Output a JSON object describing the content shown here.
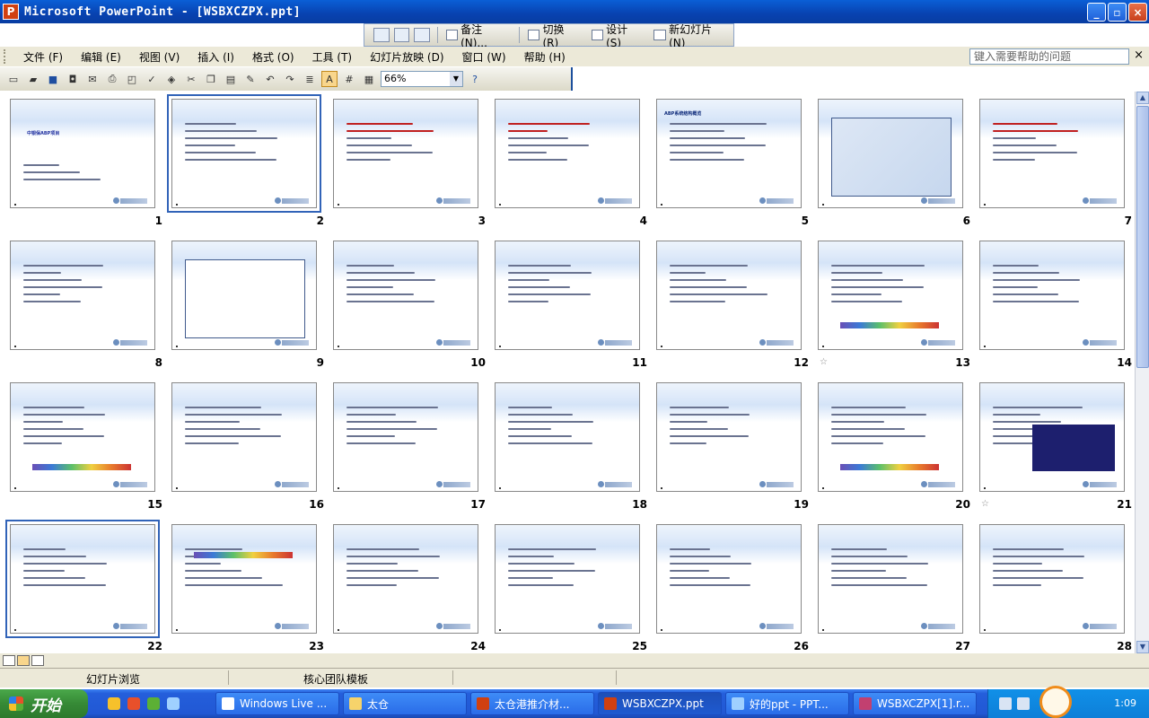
{
  "window": {
    "title": "Microsoft PowerPoint - [WSBXCZPX.ppt]",
    "icon_letter": "P",
    "buttons": [
      "_",
      "▫",
      "×"
    ]
  },
  "float_toolbar": {
    "notes_label": "备注 (N)...",
    "transition_label": "切换 (R)",
    "design_label": "设计 (S)",
    "new_slide_label": "新幻灯片 (N)"
  },
  "menubar": {
    "items": [
      "文件 (F)",
      "编辑 (E)",
      "视图 (V)",
      "插入 (I)",
      "格式 (O)",
      "工具 (T)",
      "幻灯片放映 (D)",
      "窗口 (W)",
      "帮助 (H)"
    ],
    "help_placeholder": "键入需要帮助的问题",
    "close": "×"
  },
  "toolbar": {
    "zoom": "66%",
    "icons": [
      "new-icon",
      "open-icon",
      "save-icon",
      "permission-icon",
      "email-icon",
      "print-icon",
      "print-preview-icon",
      "spelling-icon",
      "research-icon",
      "cut-icon",
      "copy-icon",
      "paste-icon",
      "format-painter-icon",
      "undo-icon",
      "redo-icon",
      "expand-icon",
      "show-formatting-icon",
      "grid-icon",
      "color-icon",
      "help-icon"
    ]
  },
  "slides": [
    {
      "num": "1",
      "title": "中银保ABP项目",
      "kind": "title"
    },
    {
      "num": "2",
      "title": "",
      "kind": "text",
      "selected": true
    },
    {
      "num": "3",
      "title": "",
      "kind": "text"
    },
    {
      "num": "4",
      "title": "",
      "kind": "text"
    },
    {
      "num": "5",
      "title": "ABP系统结构概览",
      "kind": "text"
    },
    {
      "num": "6",
      "title": "",
      "kind": "diagram"
    },
    {
      "num": "7",
      "title": "",
      "kind": "text"
    },
    {
      "num": "8",
      "title": "",
      "kind": "text"
    },
    {
      "num": "9",
      "title": "",
      "kind": "diagram9"
    },
    {
      "num": "10",
      "title": "",
      "kind": "text"
    },
    {
      "num": "11",
      "title": "",
      "kind": "text"
    },
    {
      "num": "12",
      "title": "",
      "kind": "text"
    },
    {
      "num": "13",
      "title": "",
      "kind": "bar",
      "star": true
    },
    {
      "num": "14",
      "title": "",
      "kind": "text"
    },
    {
      "num": "15",
      "title": "",
      "kind": "bar"
    },
    {
      "num": "16",
      "title": "",
      "kind": "text"
    },
    {
      "num": "17",
      "title": "",
      "kind": "text"
    },
    {
      "num": "18",
      "title": "",
      "kind": "text"
    },
    {
      "num": "19",
      "title": "",
      "kind": "text"
    },
    {
      "num": "20",
      "title": "",
      "kind": "bar"
    },
    {
      "num": "21",
      "title": "",
      "kind": "dark",
      "star": true
    },
    {
      "num": "22",
      "title": "",
      "kind": "text",
      "selected": true
    },
    {
      "num": "23",
      "title": "",
      "kind": "bar"
    },
    {
      "num": "24",
      "title": "",
      "kind": "text"
    },
    {
      "num": "25",
      "title": "",
      "kind": "text"
    },
    {
      "num": "26",
      "title": "",
      "kind": "text"
    },
    {
      "num": "27",
      "title": "",
      "kind": "text"
    },
    {
      "num": "28",
      "title": "",
      "kind": "text"
    }
  ],
  "status": {
    "view": "幻灯片浏览",
    "template": "核心团队模板"
  },
  "taskbar": {
    "start": "开始",
    "tasks": [
      {
        "label": "Windows Live ...",
        "active": false
      },
      {
        "label": "太仓",
        "active": false
      },
      {
        "label": "太仓港推介材...",
        "active": false
      },
      {
        "label": "WSBXCZPX.ppt",
        "active": true
      },
      {
        "label": "好的ppt - PPT...",
        "active": false
      },
      {
        "label": "WSBXCZPX[1].r...",
        "active": false
      }
    ],
    "clock": "1:09"
  },
  "colors": {
    "titlebar": "#0a5fd6",
    "menu_bg": "#ece9d8",
    "selection": "#3163b8",
    "taskbar": "#245edb",
    "start": "#368a36"
  }
}
